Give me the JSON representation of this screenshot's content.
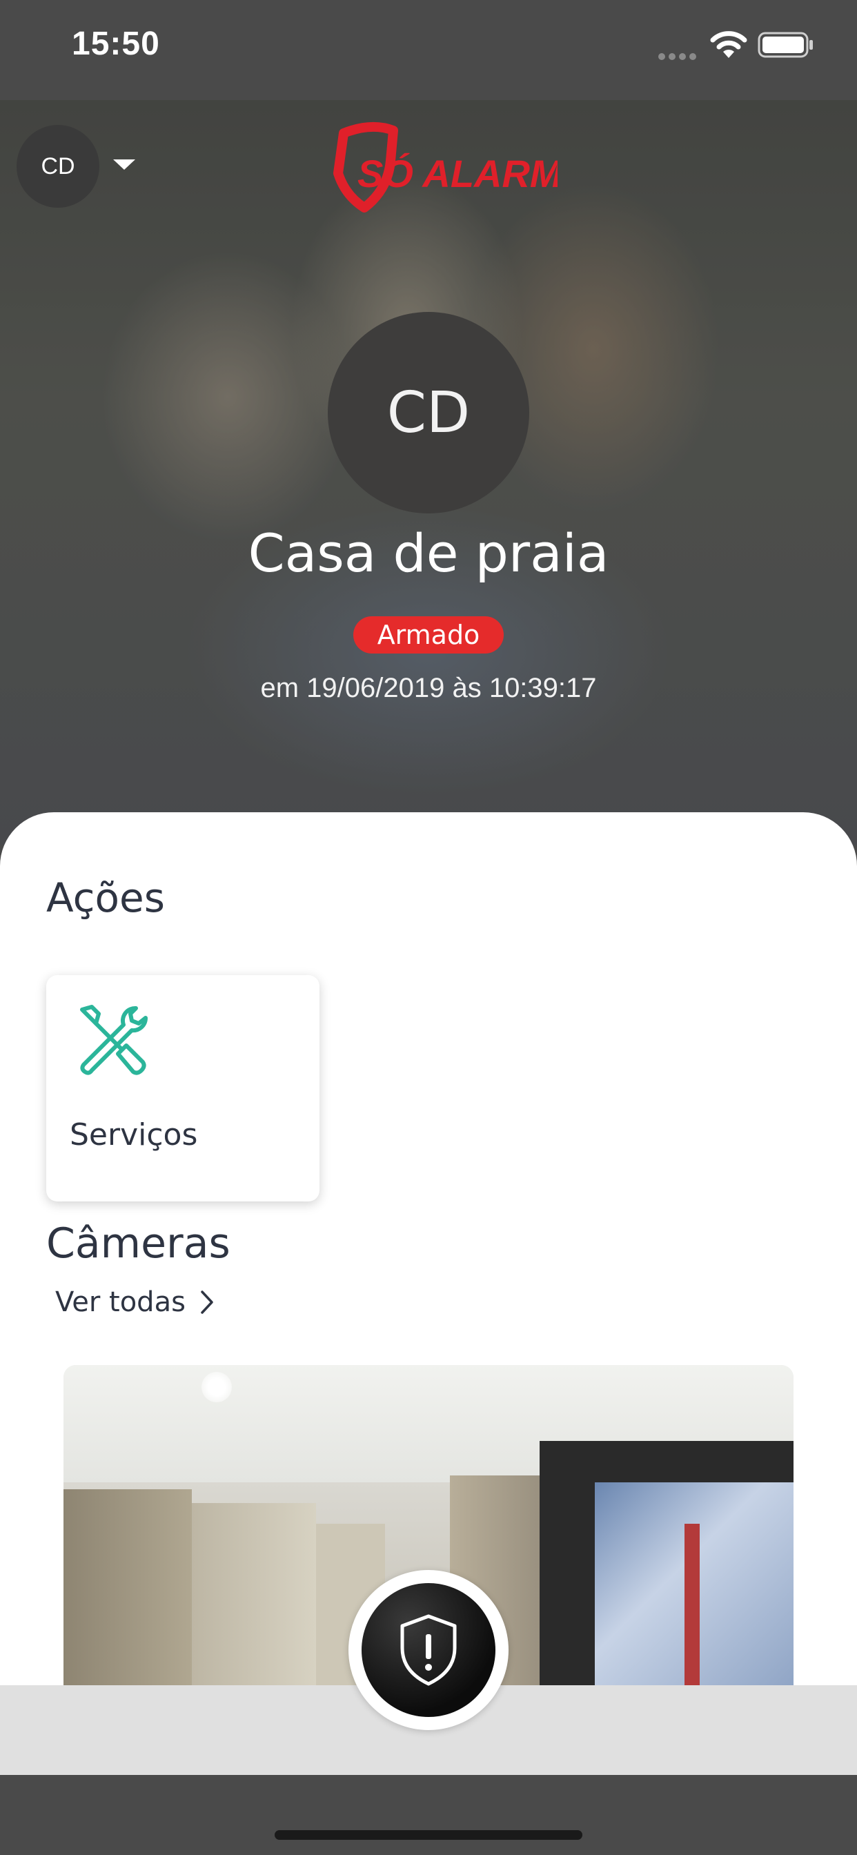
{
  "status_bar": {
    "time": "15:50"
  },
  "header": {
    "account_initials": "CD",
    "brand": "SÓ ALARME",
    "brand_color": "#e0202a"
  },
  "site": {
    "initials": "CD",
    "name": "Casa de praia",
    "status": "Armado",
    "status_color": "#e52b2b",
    "timestamp": "em 19/06/2019 às 10:39:17"
  },
  "actions": {
    "title": "Ações",
    "items": [
      {
        "label": "Serviços",
        "icon": "tools-icon",
        "icon_color": "#2bb59a"
      }
    ]
  },
  "cameras": {
    "title": "Câmeras",
    "see_all_label": "Ver todas"
  },
  "panic_button": {
    "icon": "shield-alert-icon"
  }
}
